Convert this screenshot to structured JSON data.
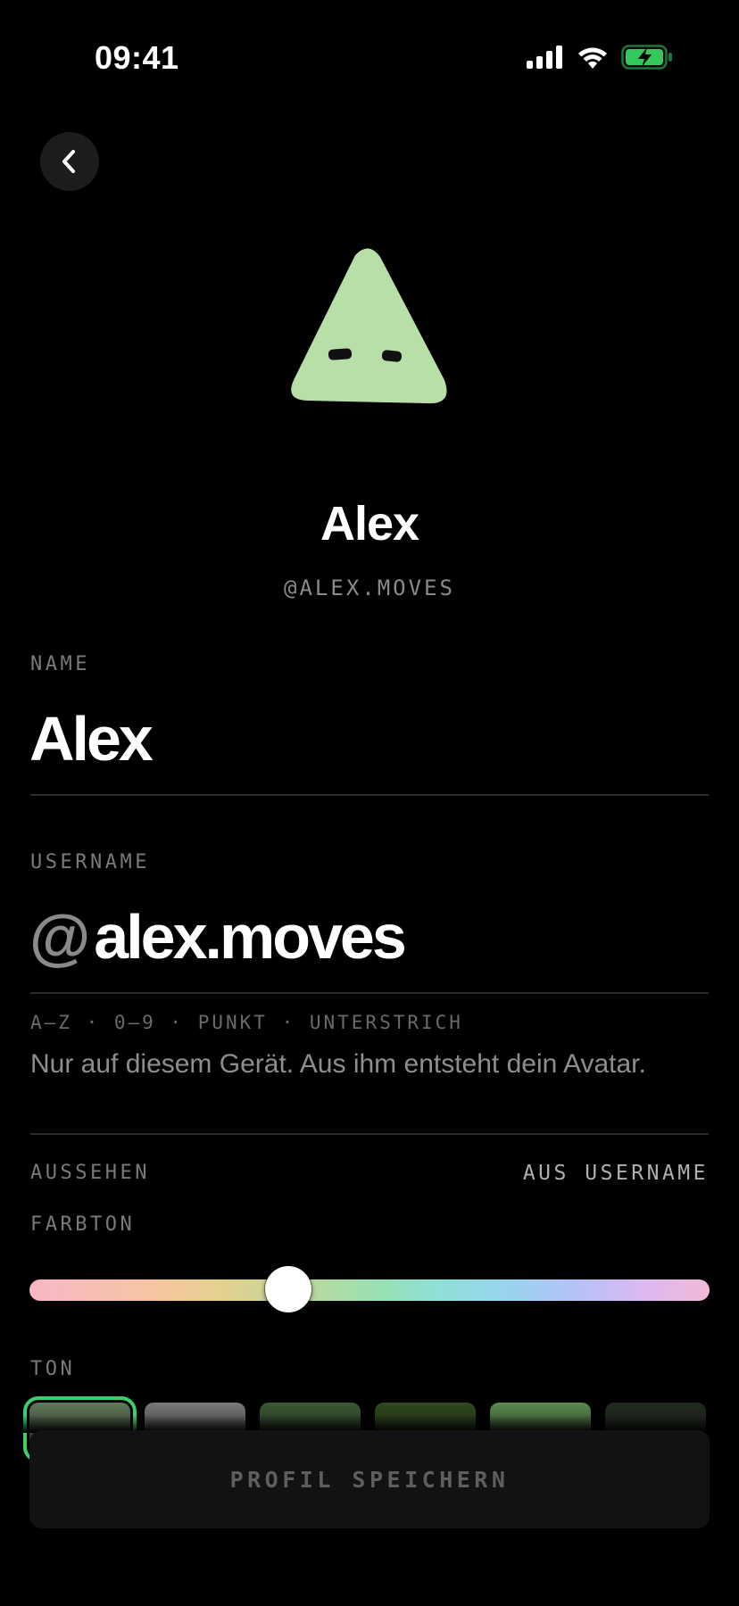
{
  "status_bar": {
    "time": "09:41",
    "icons": [
      "cellular-signal-icon",
      "wifi-icon",
      "battery-charging-icon"
    ],
    "battery_color": "#34c759"
  },
  "header": {
    "back_icon": "chevron-left-icon"
  },
  "profile": {
    "display_name": "Alex",
    "handle": "@ALEX.MOVES",
    "avatar_color": "#b8dfa8"
  },
  "form": {
    "name_label": "NAME",
    "name_value": "Alex",
    "username_label": "USERNAME",
    "username_prefix": "@",
    "username_value": "alex.moves",
    "username_rules": "A–Z · 0–9 · PUNKT · UNTERSTRICH",
    "username_hint": "Nur auf diesem Gerät. Aus ihm entsteht dein Avatar."
  },
  "appearance": {
    "section_label": "AUSSEHEN",
    "source_label": "AUS USERNAME",
    "hue_label": "FARBTON",
    "hue_value": 0.38,
    "tone_label": "TON",
    "tone_swatches": [
      {
        "color": "#5f7a5a",
        "selected": true
      },
      {
        "color": "#7a7a7a",
        "selected": false
      },
      {
        "color": "#3a5a34",
        "selected": false
      },
      {
        "color": "#2e4a1e",
        "selected": false
      },
      {
        "color": "#5c8a50",
        "selected": false
      },
      {
        "color": "#222a20",
        "selected": false
      }
    ]
  },
  "actions": {
    "save_label": "PROFIL SPEICHERN"
  }
}
